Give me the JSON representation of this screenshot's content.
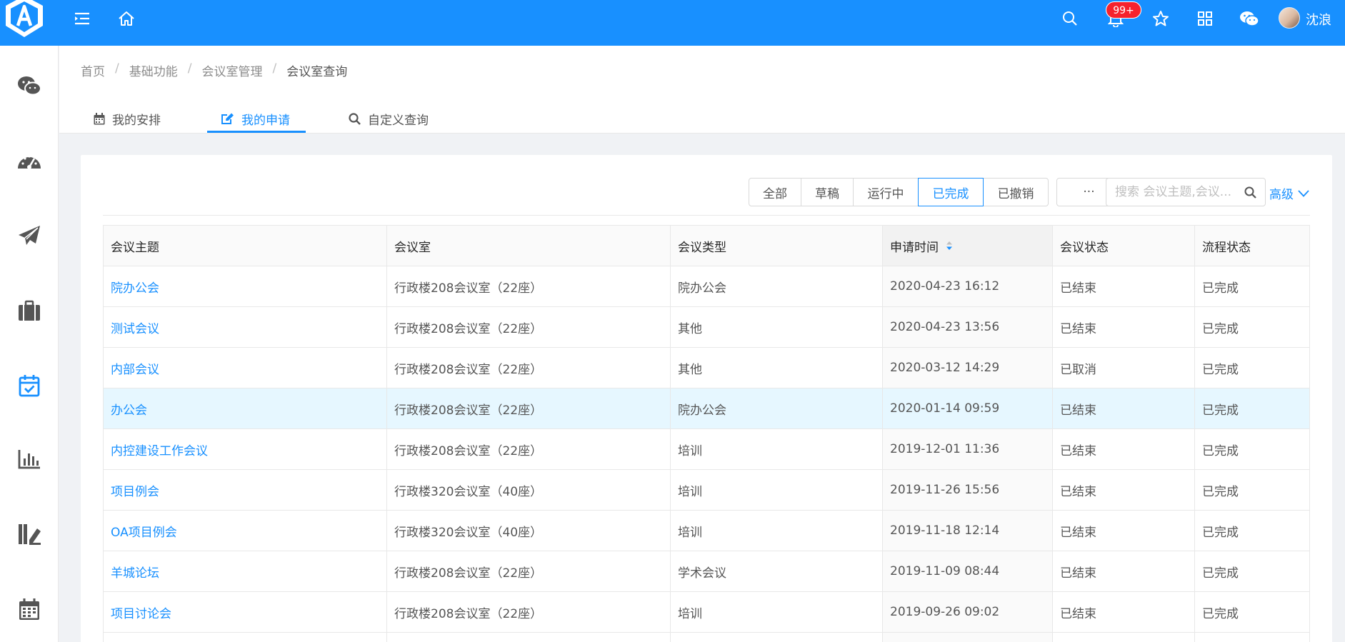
{
  "header": {
    "badge": "99+",
    "username": "沈浪"
  },
  "breadcrumb": [
    "首页",
    "基础功能",
    "会议室管理",
    "会议室查询"
  ],
  "tabs": [
    {
      "label": "我的安排",
      "icon": "calendar-icon"
    },
    {
      "label": "我的申请",
      "icon": "edit-icon",
      "active": true
    },
    {
      "label": "自定义查询",
      "icon": "search-icon"
    }
  ],
  "filters": [
    {
      "label": "全部"
    },
    {
      "label": "草稿"
    },
    {
      "label": "运行中"
    },
    {
      "label": "已完成",
      "active": true
    },
    {
      "label": "已撤销"
    }
  ],
  "more_label": "···",
  "search": {
    "placeholder": "搜索 会议主题,会议..."
  },
  "advanced_label": "高级",
  "table": {
    "columns": [
      "会议主题",
      "会议室",
      "会议类型",
      "申请时间",
      "会议状态",
      "流程状态"
    ],
    "rows": [
      [
        "院办公会",
        "行政楼208会议室（22座）",
        "院办公会",
        "2020-04-23 16:12",
        "已结束",
        "已完成"
      ],
      [
        "测试会议",
        "行政楼208会议室（22座）",
        "其他",
        "2020-04-23 13:56",
        "已结束",
        "已完成"
      ],
      [
        "内部会议",
        "行政楼208会议室（22座）",
        "其他",
        "2020-03-12 14:29",
        "已取消",
        "已完成"
      ],
      [
        "办公会",
        "行政楼208会议室（22座）",
        "院办公会",
        "2020-01-14 09:59",
        "已结束",
        "已完成"
      ],
      [
        "内控建设工作会议",
        "行政楼208会议室（22座）",
        "培训",
        "2019-12-01 11:36",
        "已结束",
        "已完成"
      ],
      [
        "项目例会",
        "行政楼320会议室（40座）",
        "培训",
        "2019-11-26 15:56",
        "已结束",
        "已完成"
      ],
      [
        "OA项目例会",
        "行政楼320会议室（40座）",
        "培训",
        "2019-11-18 12:14",
        "已结束",
        "已完成"
      ],
      [
        "羊城论坛",
        "行政楼208会议室（22座）",
        "学术会议",
        "2019-11-09 08:44",
        "已结束",
        "已完成"
      ],
      [
        "项目讨论会",
        "行政楼208会议室（22座）",
        "培训",
        "2019-09-26 09:02",
        "已结束",
        "已完成"
      ]
    ]
  },
  "colors": {
    "primary": "#1890ff",
    "badge": "#f5222d",
    "row_selected": "#e6f7ff"
  }
}
